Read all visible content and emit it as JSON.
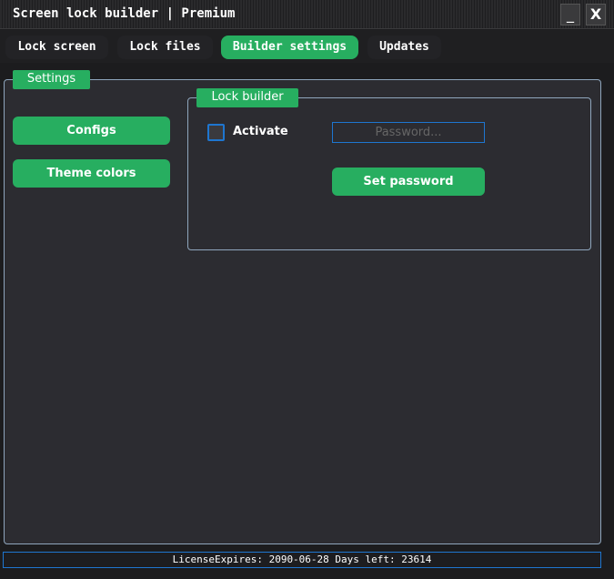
{
  "window": {
    "title": "Screen lock builder | Premium",
    "minimize": "_",
    "close": "X"
  },
  "tabs": [
    {
      "label": "Lock screen"
    },
    {
      "label": "Lock files"
    },
    {
      "label": "Builder settings",
      "active": true
    },
    {
      "label": "Updates"
    }
  ],
  "settings": {
    "legend": "Settings",
    "configs": "Configs",
    "theme_colors": "Theme colors"
  },
  "lock_builder": {
    "legend": "Lock builder",
    "activate_label": "Activate",
    "activate_checked": false,
    "password_placeholder": "Password...",
    "password_value": "",
    "set_password": "Set password"
  },
  "status": {
    "text": "LicenseExpires: 2090-06-28 Days left: 23614"
  },
  "colors": {
    "accent": "#27ae60",
    "focus": "#1e76d0"
  }
}
